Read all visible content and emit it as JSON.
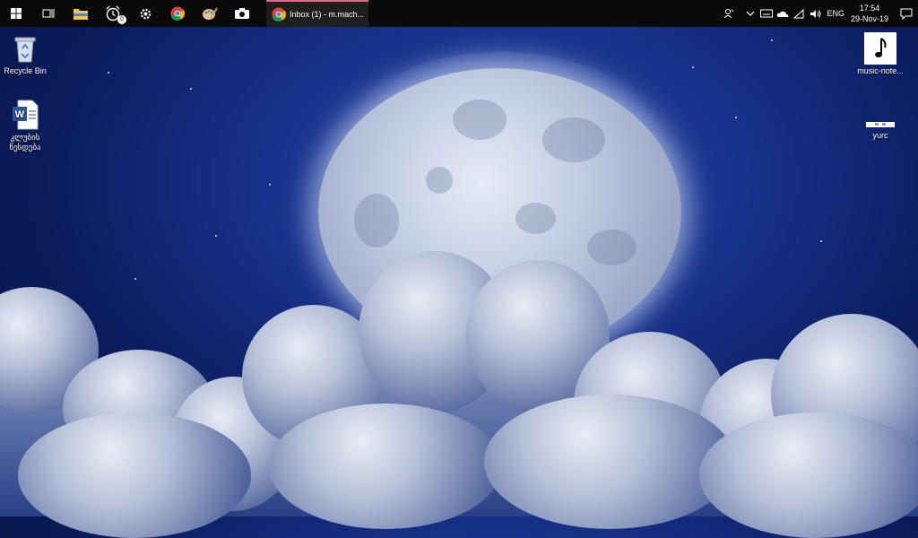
{
  "taskbar": {
    "active_app_label": "Inbox (1) - m.mach...",
    "badge_count": "0",
    "tray": {
      "language": "ENG",
      "time": "17:54",
      "date": "29-Nov-19"
    }
  },
  "desktop": {
    "left_icons": [
      {
        "label": "Recycle Bin"
      },
      {
        "label": "კლუბის წესდება"
      }
    ],
    "right_icons": [
      {
        "label": "music-note..."
      },
      {
        "label": "yurc"
      }
    ]
  },
  "colors": {
    "taskbar_bg": "#0a0a0a",
    "active_indicator": "#e06a8c",
    "wallpaper_blue": "#17318a"
  }
}
